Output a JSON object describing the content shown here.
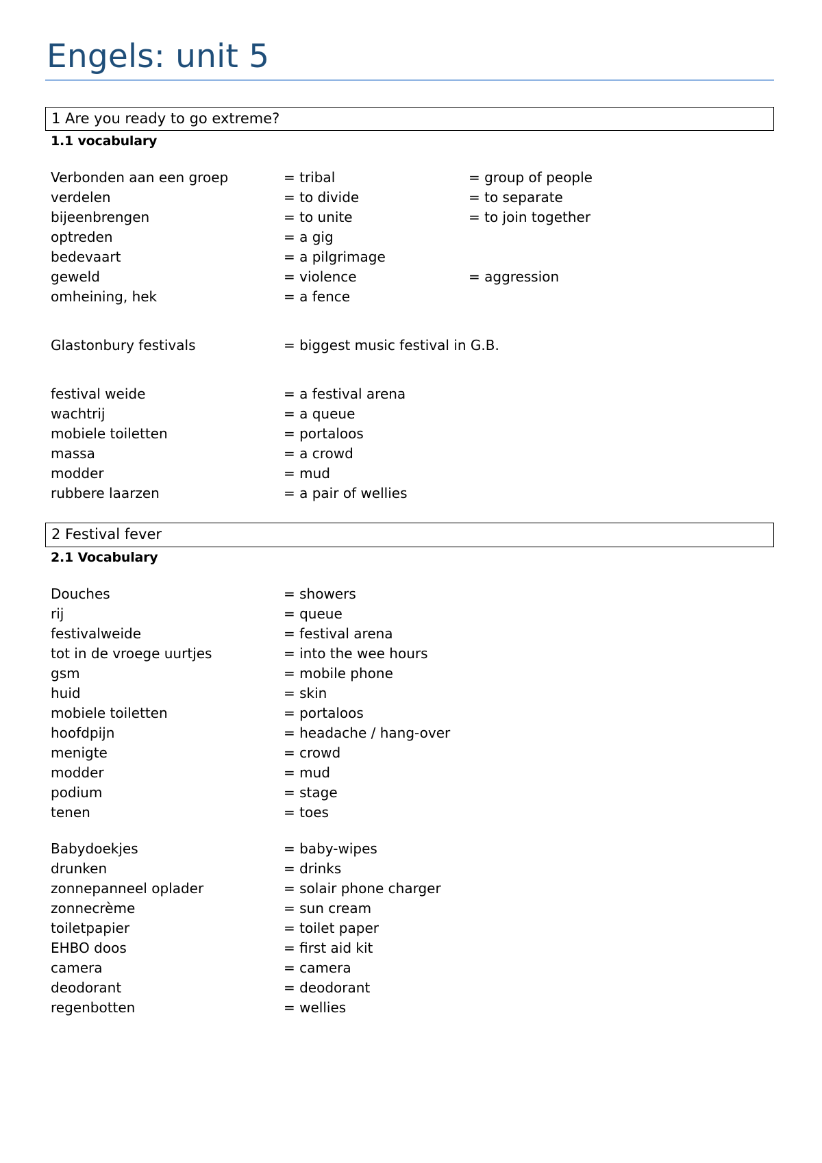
{
  "document": {
    "title": "Engels: unit 5",
    "accent_color": "#1f4e79",
    "rule_color": "#8db3e2"
  },
  "sections": [
    {
      "header": "1 Are you ready to go extreme?",
      "subheader": "1.1 vocabulary",
      "groups": [
        {
          "rows": [
            {
              "term": "Verbonden aan een groep",
              "eq1": "= tribal",
              "eq2": "= group of people"
            },
            {
              "term": "verdelen",
              "eq1": "= to divide",
              "eq2": "= to separate"
            },
            {
              "term": "bijeenbrengen",
              "eq1": "= to unite",
              "eq2": "= to join together"
            },
            {
              "term": "optreden",
              "eq1": "= a gig",
              "eq2": ""
            },
            {
              "term": "bedevaart",
              "eq1": "= a pilgrimage",
              "eq2": ""
            },
            {
              "term": "geweld",
              "eq1": "= violence",
              "eq2": "= aggression"
            },
            {
              "term": "omheining, hek",
              "eq1": "= a fence",
              "eq2": ""
            }
          ]
        },
        {
          "rows": [
            {
              "term": "Glastonbury festivals",
              "eq1": "= biggest music festival in G.B.",
              "eq2": ""
            }
          ]
        },
        {
          "rows": [
            {
              "term": "festival weide",
              "eq1": "= a festival arena",
              "eq2": ""
            },
            {
              "term": "wachtrij",
              "eq1": "= a queue",
              "eq2": ""
            },
            {
              "term": "mobiele toiletten",
              "eq1": "= portaloos",
              "eq2": ""
            },
            {
              "term": "massa",
              "eq1": "= a crowd",
              "eq2": ""
            },
            {
              "term": "modder",
              "eq1": "= mud",
              "eq2": ""
            },
            {
              "term": "rubbere laarzen",
              "eq1": "= a pair of wellies",
              "eq2": ""
            }
          ]
        }
      ]
    },
    {
      "header": "2 Festival fever",
      "subheader": "2.1 Vocabulary",
      "groups": [
        {
          "rows": [
            {
              "term": "Douches",
              "eq1": "= showers",
              "eq2": ""
            },
            {
              "term": "rij",
              "eq1": "= queue",
              "eq2": ""
            },
            {
              "term": "festivalweide",
              "eq1": "= festival arena",
              "eq2": ""
            },
            {
              "term": "tot in de vroege uurtjes",
              "eq1": "= into the wee hours",
              "eq2": ""
            },
            {
              "term": "gsm",
              "eq1": "= mobile phone",
              "eq2": ""
            },
            {
              "term": "huid",
              "eq1": "= skin",
              "eq2": ""
            },
            {
              "term": "mobiele toiletten",
              "eq1": "= portaloos",
              "eq2": ""
            },
            {
              "term": "hoofdpijn",
              "eq1": "= headache / hang-over",
              "eq2": ""
            },
            {
              "term": "menigte",
              "eq1": "= crowd",
              "eq2": ""
            },
            {
              "term": "modder",
              "eq1": "= mud",
              "eq2": ""
            },
            {
              "term": "podium",
              "eq1": "= stage",
              "eq2": ""
            },
            {
              "term": "tenen",
              "eq1": "= toes",
              "eq2": ""
            }
          ]
        },
        {
          "rows": [
            {
              "term": "Babydoekjes",
              "eq1": "= baby-wipes",
              "eq2": ""
            },
            {
              "term": "drunken",
              "eq1": "= drinks",
              "eq2": ""
            },
            {
              "term": "zonnepanneel oplader",
              "eq1": "= solair phone charger",
              "eq2": ""
            },
            {
              "term": "zonnecrème",
              "eq1": "= sun cream",
              "eq2": ""
            },
            {
              "term": "toiletpapier",
              "eq1": "= toilet paper",
              "eq2": ""
            },
            {
              "term": "EHBO doos",
              "eq1": "= first aid kit",
              "eq2": ""
            },
            {
              "term": "camera",
              "eq1": "= camera",
              "eq2": ""
            },
            {
              "term": "deodorant",
              "eq1": "= deodorant",
              "eq2": ""
            },
            {
              "term": "regenbotten",
              "eq1": "= wellies",
              "eq2": ""
            }
          ]
        }
      ]
    }
  ]
}
